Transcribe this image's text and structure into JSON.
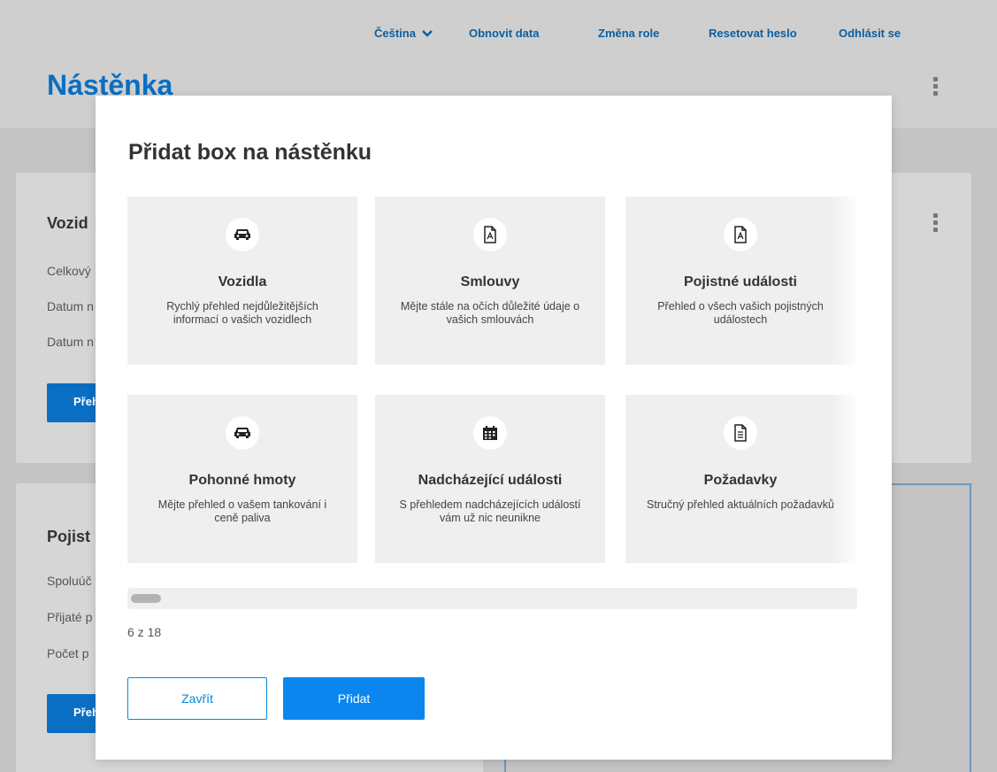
{
  "topnav": {
    "language": "Čeština",
    "refresh": "Obnovit data",
    "role": "Změna role",
    "reset_password": "Resetovat heslo",
    "logout": "Odhlásit se"
  },
  "page": {
    "title": "Nástěnka"
  },
  "background": {
    "card1": {
      "title": "Vozid",
      "rows": [
        "Celkový",
        "Datum n",
        "Datum n"
      ],
      "button": "Přeh"
    },
    "card2": {
      "title": "Pojist",
      "rows": [
        "Spoluúč",
        "Přijaté p",
        "Počet p"
      ],
      "button": "Přeh"
    }
  },
  "modal": {
    "title": "Přidat box na nástěnku",
    "tiles": [
      {
        "title": "Vozidla",
        "desc": "Rychlý přehled nejdůležitějších informací o vašich vozidlech",
        "icon": "car-icon"
      },
      {
        "title": "Smlouvy",
        "desc": "Mějte stále na očích důležité údaje o vašich smlouvách",
        "icon": "pdf-icon"
      },
      {
        "title": "Pojistné události",
        "desc": "Přehled o všech vašich pojistných událostech",
        "icon": "pdf-icon"
      },
      {
        "title": "Pohonné hmoty",
        "desc": "Mějte přehled o vašem tankování i ceně paliva",
        "icon": "car-icon"
      },
      {
        "title": "Nadcházející události",
        "desc": "S přehledem nadcházejících událostí vám už nic neunikne",
        "icon": "calendar-icon"
      },
      {
        "title": "Požadavky",
        "desc": "Stručný přehled aktuálních požadavků",
        "icon": "document-icon"
      }
    ],
    "counter": "6 z 18",
    "close_label": "Zavřít",
    "add_label": "Přidat"
  },
  "colors": {
    "brand": "#0a6fc2",
    "button": "#0a86ee",
    "tile_bg": "#efefef"
  }
}
